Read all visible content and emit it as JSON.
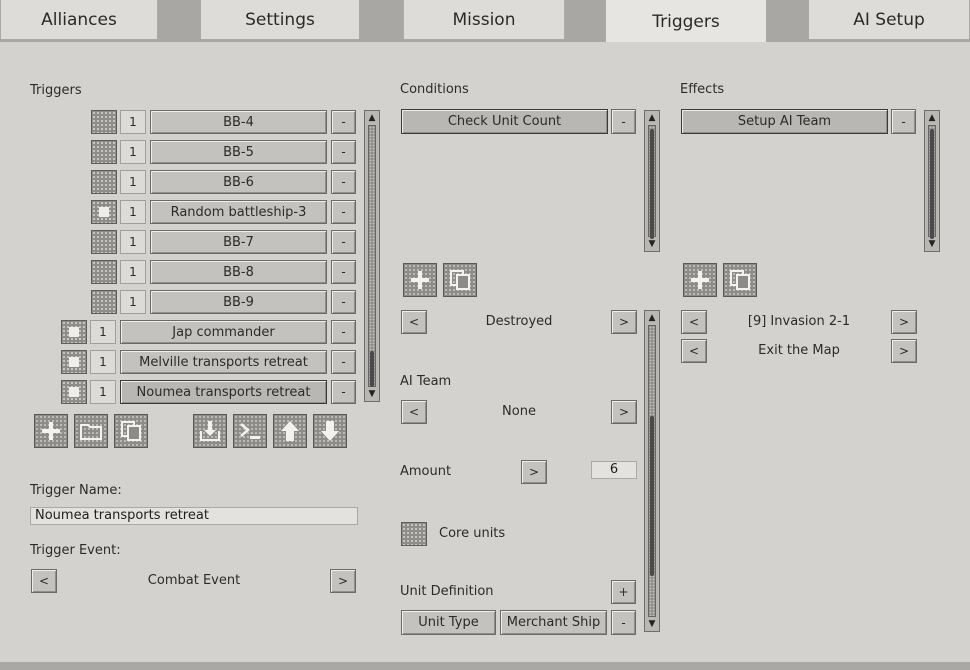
{
  "tabs": [
    "Alliances",
    "Settings",
    "Mission",
    "Triggers",
    "AI Setup"
  ],
  "triggers": {
    "heading": "Triggers",
    "items": [
      {
        "count": "1",
        "name": "BB-4",
        "checked": false,
        "indent": true
      },
      {
        "count": "1",
        "name": "BB-5",
        "checked": false,
        "indent": true
      },
      {
        "count": "1",
        "name": "BB-6",
        "checked": false,
        "indent": true
      },
      {
        "count": "1",
        "name": "Random battleship-3",
        "checked": true,
        "indent": true
      },
      {
        "count": "1",
        "name": "BB-7",
        "checked": false,
        "indent": true
      },
      {
        "count": "1",
        "name": "BB-8",
        "checked": false,
        "indent": true
      },
      {
        "count": "1",
        "name": "BB-9",
        "checked": false,
        "indent": true
      },
      {
        "count": "1",
        "name": "Jap commander",
        "checked": true,
        "indent": false
      },
      {
        "count": "1",
        "name": "Melville transports retreat",
        "checked": true,
        "indent": false
      },
      {
        "count": "1",
        "name": "Noumea transports retreat",
        "checked": true,
        "indent": false,
        "selected": true
      }
    ],
    "remove_label": "-",
    "name_label": "Trigger Name:",
    "name_value": "Noumea transports retreat",
    "event_label": "Trigger Event:",
    "event_value": "Combat Event",
    "prev": "<",
    "next": ">"
  },
  "conditions": {
    "heading": "Conditions",
    "items": [
      "Check Unit Count"
    ],
    "remove_label": "-",
    "destroyed_value": "Destroyed",
    "ai_team_label": "AI Team",
    "ai_team_value": "None",
    "amount_label": "Amount",
    "amount_value": "6",
    "core_units_label": "Core units",
    "unit_definition_label": "Unit Definition",
    "add_label": "+",
    "unit_type_label": "Unit Type",
    "unit_type_value": "Merchant Ship",
    "prev": "<",
    "next": ">"
  },
  "effects": {
    "heading": "Effects",
    "items": [
      "Setup AI Team"
    ],
    "remove_label": "-",
    "row1_value": "[9] Invasion 2-1",
    "row2_value": "Exit the Map",
    "prev": "<",
    "next": ">"
  },
  "icons": [
    "plus-icon",
    "folder-icon",
    "copy-icon",
    "import-icon",
    "console-icon",
    "arrow-up-icon",
    "arrow-down-icon"
  ]
}
